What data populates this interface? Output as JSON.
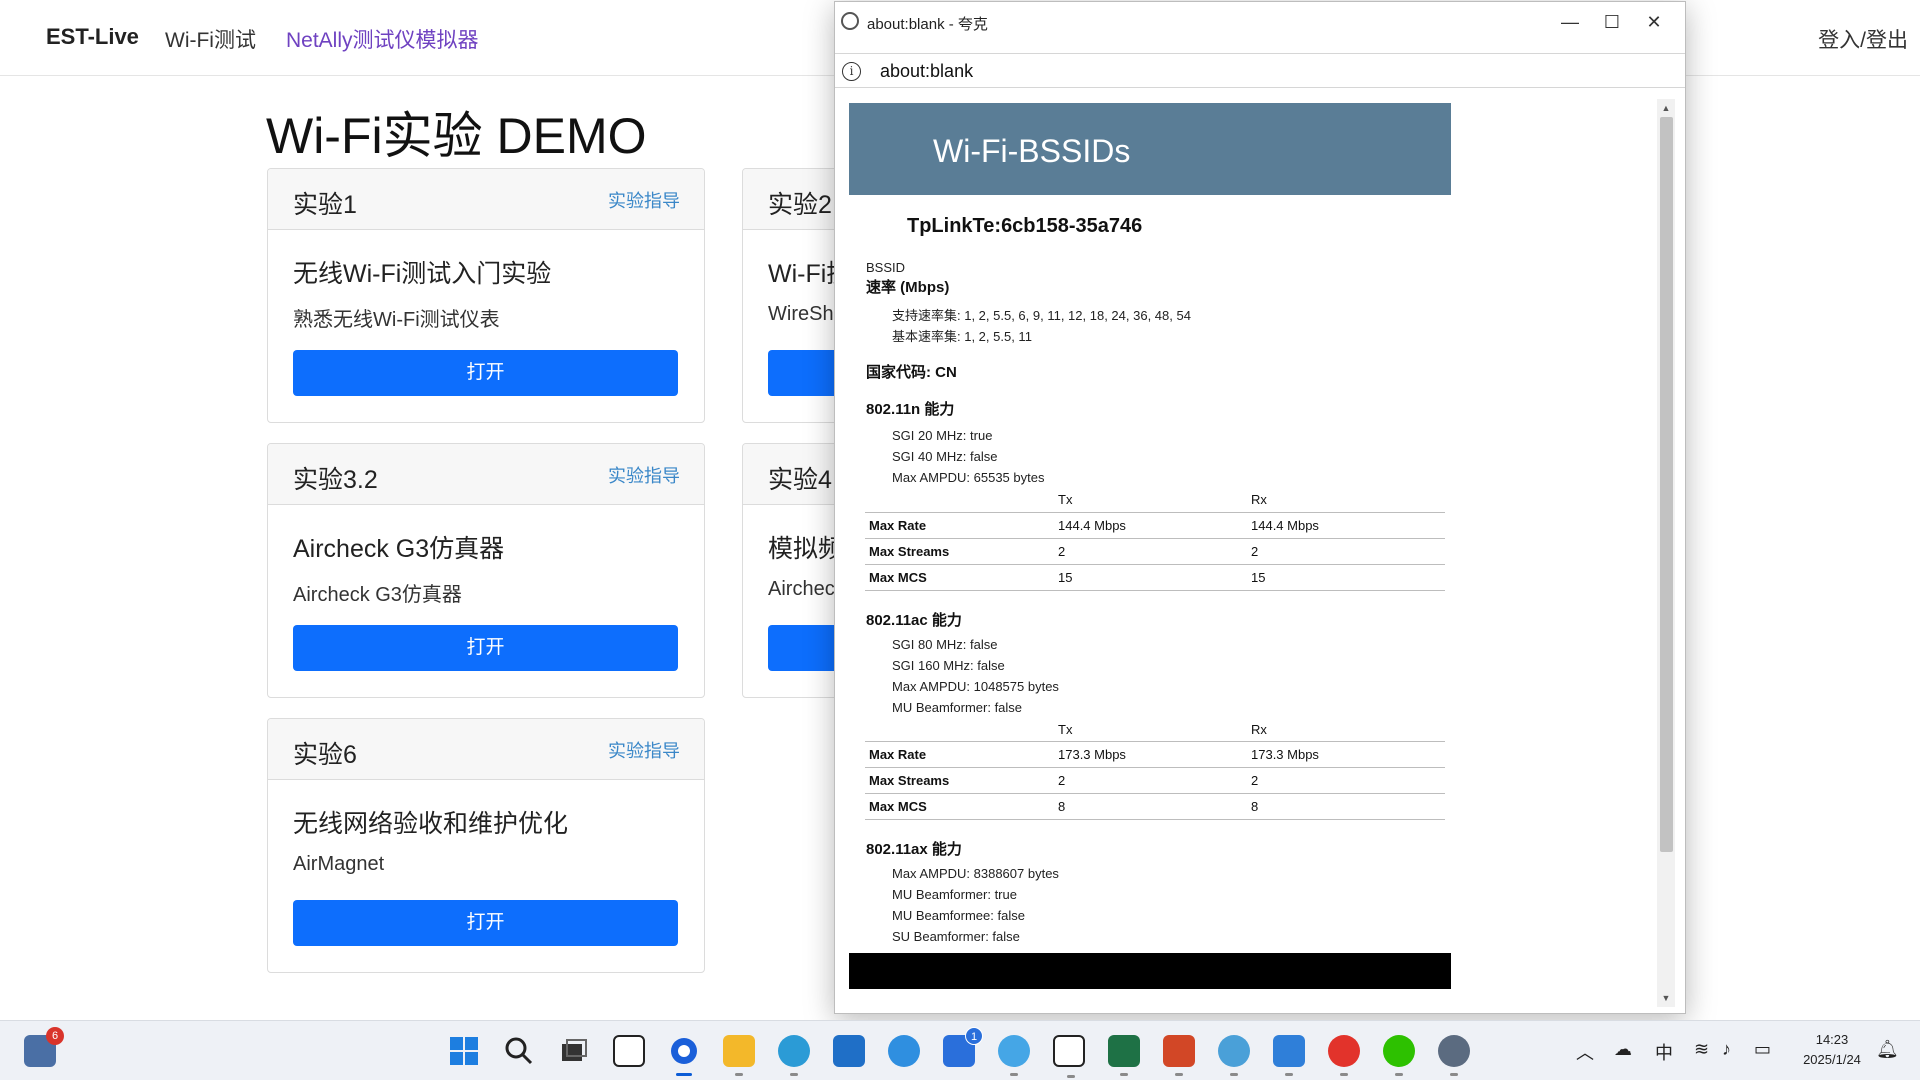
{
  "nav": {
    "brand": "EST-Live",
    "links": [
      "Wi-Fi测试",
      "NetAlly测试仪模拟器"
    ],
    "login": "登入/登出"
  },
  "page": {
    "title": "Wi-Fi实验 DEMO"
  },
  "cards": [
    {
      "header": "实验1",
      "guide": "实验指导",
      "title": "无线Wi-Fi测试入门实验",
      "subtitle": "熟悉无线Wi-Fi测试仪表",
      "button": "打开"
    },
    {
      "header": "实验2",
      "title": "Wi-Fi抓",
      "subtitle": "WireSh"
    },
    {
      "header": "实验3.2",
      "guide": "实验指导",
      "title": "Aircheck G3仿真器",
      "subtitle": "Aircheck G3仿真器",
      "button": "打开"
    },
    {
      "header": "实验4",
      "title": "模拟频",
      "subtitle": "Airchec"
    },
    {
      "header": "实验6",
      "guide": "实验指导",
      "title": "无线网络验收和维护优化",
      "subtitle": "AirMagnet",
      "button": "打开"
    }
  ],
  "popup": {
    "window_title": "about:blank - 夸克",
    "controls": [
      "—",
      "☐",
      "✕"
    ],
    "address": "about:blank",
    "info_icon": "ⓘ",
    "banner": "Wi-Fi-BSSIDs",
    "ssid": "TpLinkTe:6cb158-35a746",
    "bssid_label": "BSSID",
    "rate_label": "速率 (Mbps)",
    "supported_rates": "支持速率集: 1, 2, 5.5, 6, 9, 11, 12, 18, 24, 36, 48, 54",
    "basic_rates": "基本速率集: 1, 2, 5.5, 11",
    "country": "国家代码: CN",
    "n": {
      "title": "802.11n 能力",
      "items": [
        "SGI 20 MHz: true",
        "SGI 40 MHz: false",
        "Max AMPDU: 65535 bytes"
      ],
      "headers": [
        "",
        "Tx",
        "Rx"
      ],
      "rows": [
        [
          "Max Rate",
          "144.4 Mbps",
          "144.4 Mbps"
        ],
        [
          "Max Streams",
          "2",
          "2"
        ],
        [
          "Max MCS",
          "15",
          "15"
        ]
      ]
    },
    "ac": {
      "title": "802.11ac 能力",
      "items": [
        "SGI 80 MHz: false",
        "SGI 160 MHz: false",
        "Max AMPDU: 1048575 bytes",
        "MU Beamformer: false"
      ],
      "headers": [
        "",
        "Tx",
        "Rx"
      ],
      "rows": [
        [
          "Max Rate",
          "173.3 Mbps",
          "173.3 Mbps"
        ],
        [
          "Max Streams",
          "2",
          "2"
        ],
        [
          "Max MCS",
          "8",
          "8"
        ]
      ]
    },
    "ax": {
      "title": "802.11ax 能力",
      "items": [
        "Max AMPDU: 8388607 bytes",
        "MU Beamformer: true",
        "MU Beamformee: false",
        "SU Beamformer: false"
      ]
    }
  },
  "taskbar": {
    "widgets_badge": "6",
    "todo_badge": "1",
    "tray_ime": "中",
    "time": "14:23",
    "date": "2025/1/24"
  }
}
